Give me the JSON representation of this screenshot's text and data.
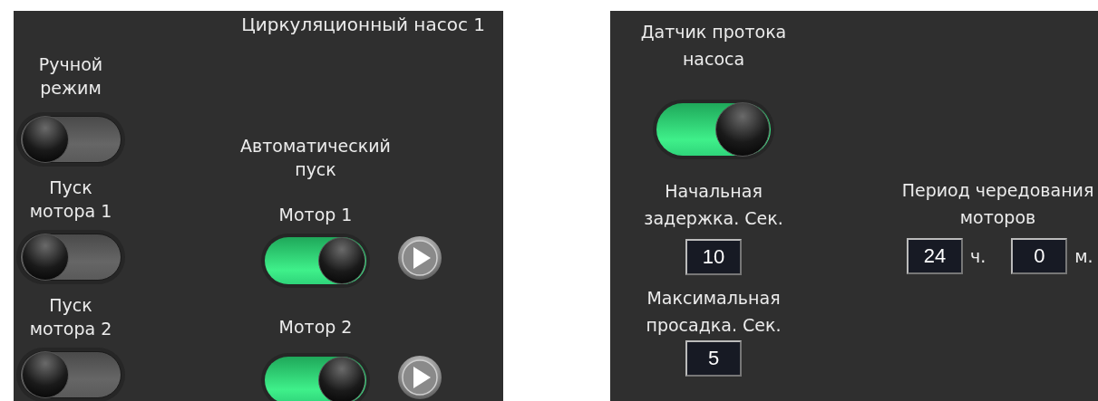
{
  "left_panel": {
    "title": "Циркуляционный насос 1",
    "manual": [
      {
        "label": "Ручной режим",
        "on": false
      },
      {
        "label": "Пуск мотора 1",
        "on": false
      },
      {
        "label": "Пуск мотора 2",
        "on": false
      }
    ],
    "auto": {
      "label": "Автоматический пуск",
      "motors": [
        {
          "label": "Мотор 1",
          "on": true
        },
        {
          "label": "Мотор 2",
          "on": true
        }
      ]
    }
  },
  "right_panel": {
    "flow_sensor": {
      "label": "Датчик протока насоса",
      "on": true
    },
    "initial_delay": {
      "label": "Начальная задержка. Сек.",
      "value": "10"
    },
    "max_drop": {
      "label": "Максимальная просадка. Сек.",
      "value": "5"
    },
    "rotation_period": {
      "label": "Период чередования моторов",
      "hours": {
        "value": "24",
        "unit": "ч."
      },
      "minutes": {
        "value": "0",
        "unit": "м."
      }
    }
  }
}
